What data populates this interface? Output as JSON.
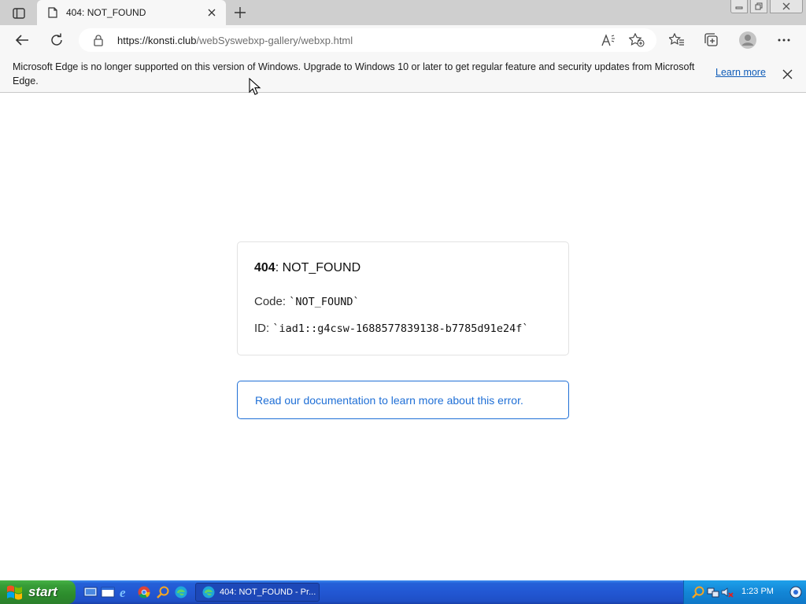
{
  "browser": {
    "tab": {
      "title": "404: NOT_FOUND"
    },
    "address": {
      "host": "https://konsti.club",
      "path": "/webSyswebxp-gallery/webxp.html"
    }
  },
  "infobar": {
    "message": "Microsoft Edge is no longer supported on this version of Windows. Upgrade to Windows 10 or later to get regular feature and security updates from Microsoft Edge.",
    "learn_more": "Learn more"
  },
  "error": {
    "status_code": "404",
    "status_text": ": NOT_FOUND",
    "code_label": "Code: ",
    "code_value": "`NOT_FOUND`",
    "id_label": "ID: ",
    "id_value": "`iad1::g4csw-1688577839138-b7785d91e24f`"
  },
  "doc_link": {
    "label": "Read our documentation to learn more about this error."
  },
  "taskbar": {
    "start_label": "start",
    "task_title": "404: NOT_FOUND - Pr...",
    "clock": "1:23 PM"
  },
  "colors": {
    "link": "#1f6fd6",
    "taskbar": "#2257d3",
    "start": "#389e38"
  }
}
